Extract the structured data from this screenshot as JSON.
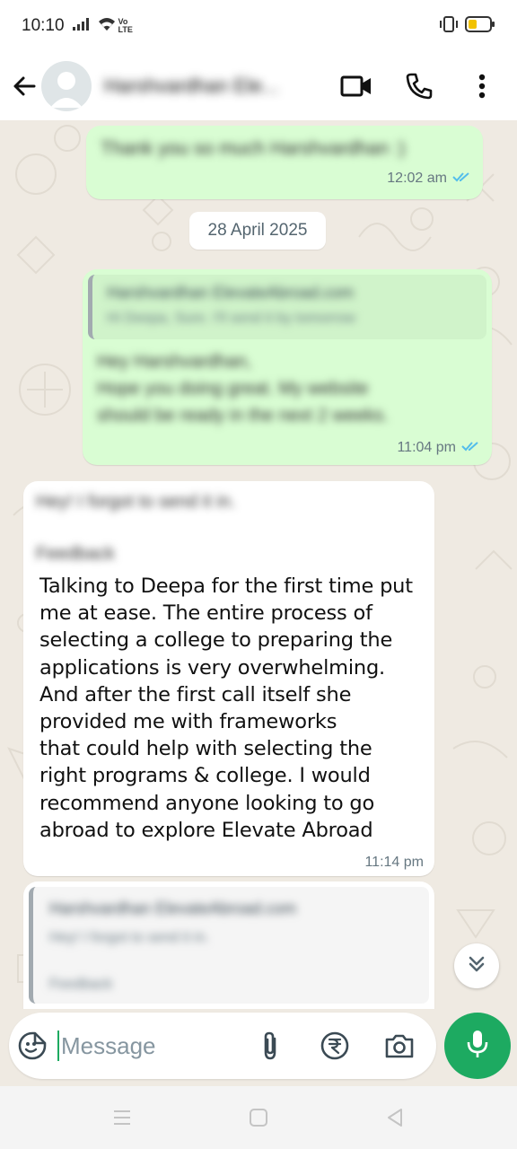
{
  "status_bar": {
    "time": "10:10",
    "network": "Vo LTE",
    "battery_icon": "battery-low-icon",
    "vibrate_icon": "vibrate-icon"
  },
  "header": {
    "contact_name": "Harshvardhan Ele...",
    "icons": [
      "back-arrow-icon",
      "avatar",
      "video-call-icon",
      "voice-call-icon",
      "more-options-icon"
    ]
  },
  "chat": {
    "messages": [
      {
        "direction": "outgoing",
        "text": "Thank you so much Harshvardhan :)",
        "time": "12:02 am",
        "status": "read"
      },
      {
        "type": "date",
        "label": "28 April 2025"
      },
      {
        "direction": "outgoing",
        "quote_author": "Harshvardhan ElevateAbroad.com",
        "quote_text": "Hi Deepa, Sure. I'll send it by tomorrow",
        "text_lines": [
          "Hey Harshvardhan,",
          "Hope you doing great. My website",
          "should be ready in the next 2 weeks."
        ],
        "time": "11:04 pm",
        "status": "read"
      },
      {
        "direction": "incoming",
        "blurred_lines": [
          "Hey! I forgot to send it in.",
          "Feedback"
        ],
        "text_lines": [
          "Talking to Deepa for the first time put",
          "me at ease. The entire process of",
          "selecting a college to preparing the",
          "applications is very overwhelming.",
          "And after the first call itself she",
          "provided me with frameworks",
          "that could help with selecting the",
          "right programs & college. I would",
          "recommend anyone looking to go",
          "abroad to explore Elevate Abroad"
        ],
        "time": "11:14 pm"
      },
      {
        "direction": "incoming",
        "quote_author": "Harshvardhan ElevateAbroad.com",
        "quote_text": "Hey! I forgot to send it in.",
        "quote_extra": "Feedback"
      }
    ]
  },
  "composer": {
    "placeholder": "Message",
    "icons": [
      "emoji-sticker-icon",
      "attach-icon",
      "rupee-payment-icon",
      "camera-icon",
      "microphone-icon"
    ]
  },
  "nav_bar": {
    "icons": [
      "recents-icon",
      "home-icon",
      "back-icon"
    ]
  },
  "colors": {
    "outgoing_bubble": "#d9fdd3",
    "incoming_bubble": "#ffffff",
    "chat_background": "#efeae2",
    "accent_green": "#1daa61",
    "read_tick": "#53bdeb"
  }
}
